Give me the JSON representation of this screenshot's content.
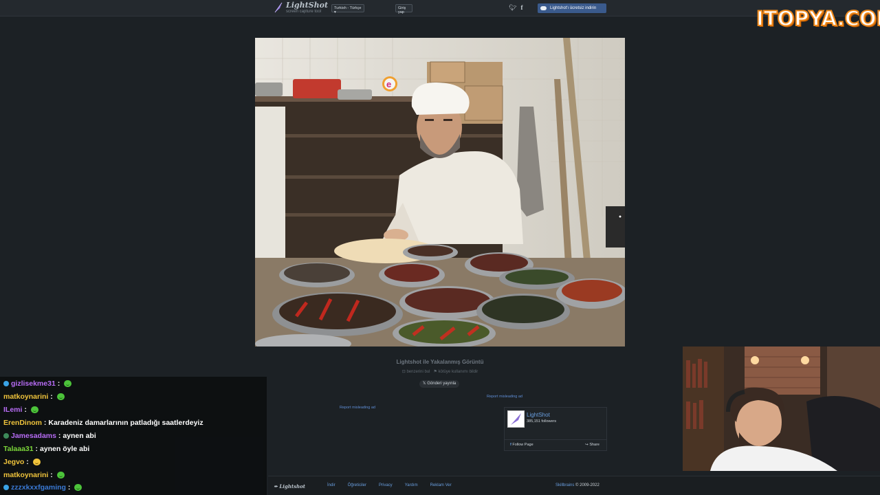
{
  "topbar": {
    "logo_name": "LightShot",
    "logo_tag": "screen capture tool",
    "language": "Turkish - Türkçe",
    "login": "Giriş yap",
    "download": "Lightshot'ı ücretsiz indirin"
  },
  "watermark": "ITOPYA.COM",
  "page": {
    "caption": "Lightshot ile Yakalanmış Görüntü",
    "similar": "benzerini bul",
    "report_abuse": "kötüye kullanımı bildir",
    "send_button": "Gönderi yayınla",
    "report_ad_1": "Report misleading ad",
    "report_ad_2": "Report misleading ad"
  },
  "fb": {
    "page_name": "LightShot",
    "followers": "385,151 followers",
    "follow": "Follow Page",
    "share": "Share"
  },
  "footer": {
    "logo": "Lightshot",
    "links": [
      "İndir",
      "Öğreticiler",
      "Privacy",
      "Yardım",
      "Reklam Ver"
    ],
    "company": "Skillbrains",
    "copyright": "© 2009-2022"
  },
  "chat": [
    {
      "user": "gizlisekme31",
      "color": "#b76cf5",
      "badge": "#3aa3e6",
      "text": "",
      "emote": "green"
    },
    {
      "user": "matkoynarini",
      "color": "#f0c43c",
      "badge": "",
      "text": "",
      "emote": "green"
    },
    {
      "user": "ILemi",
      "color": "#b76cf5",
      "badge": "",
      "text": "",
      "emote": "green"
    },
    {
      "user": "ErenDinom",
      "color": "#f0c43c",
      "badge": "",
      "text": "Karadeniz damarlarının patladığı saatlerdeyiz",
      "emote": ""
    },
    {
      "user": "Jamesadams",
      "color": "#b76cf5",
      "badge": "#3d8a5a",
      "text": "aynen abi",
      "emote": ""
    },
    {
      "user": "Talaaa31",
      "color": "#7cd63a",
      "badge": "",
      "text": "aynen öyle abi",
      "emote": ""
    },
    {
      "user": "Jegvo",
      "color": "#f0c43c",
      "badge": "",
      "text": "",
      "emote": "yellow"
    },
    {
      "user": "matkoynarini",
      "color": "#f0c43c",
      "badge": "",
      "text": "",
      "emote": "green"
    },
    {
      "user": "zzzxkxxfgaming",
      "color": "#3a7ad6",
      "badge": "#3aa3e6",
      "text": "",
      "emote": "green"
    }
  ]
}
